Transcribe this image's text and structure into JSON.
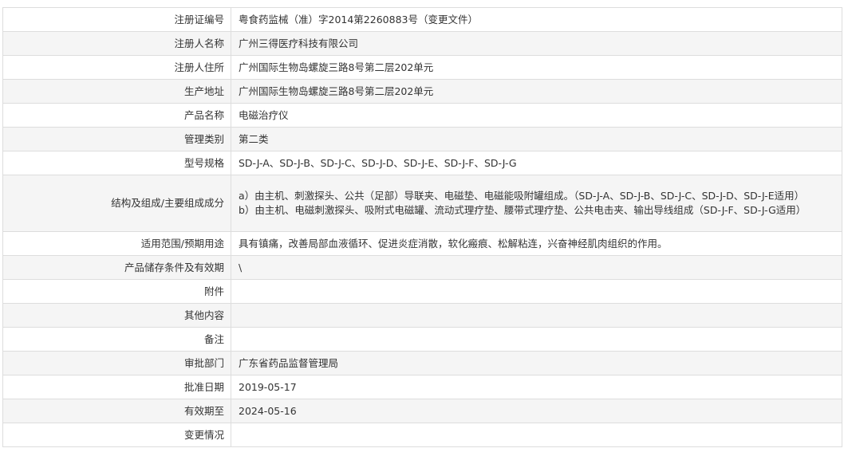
{
  "rows": [
    {
      "label": "注册证编号",
      "value": "粤食药监械（准）字2014第2260883号（变更文件）"
    },
    {
      "label": "注册人名称",
      "value": "广州三得医疗科技有限公司"
    },
    {
      "label": "注册人住所",
      "value": "广州国际生物岛螺旋三路8号第二层202单元"
    },
    {
      "label": "生产地址",
      "value": "广州国际生物岛螺旋三路8号第二层202单元"
    },
    {
      "label": "产品名称",
      "value": "电磁治疗仪"
    },
    {
      "label": "管理类别",
      "value": "第二类"
    },
    {
      "label": "型号规格",
      "value": "SD-J-A、SD-J-B、SD-J-C、SD-J-D、SD-J-E、SD-J-F、SD-J-G"
    },
    {
      "label": "结构及组成/主要组成成分",
      "lines": [
        "a）由主机、刺激探头、公共（足部）导联夹、电磁垫、电磁能吸附罐组成。（SD-J-A、SD-J-B、SD-J-C、SD-J-D、SD-J-E适用）",
        "b）由主机、电磁刺激探头、吸附式电磁罐、流动式理疗垫、腰带式理疗垫、公共电击夹、输出导线组成（SD-J-F、SD-J-G适用）"
      ]
    },
    {
      "label": "适用范围/预期用途",
      "value": "具有镇痛，改善局部血液循环、促进炎症消散，软化瘢痕、松解粘连，兴奋神经肌肉组织的作用。"
    },
    {
      "label": "产品储存条件及有效期",
      "value": "\\"
    },
    {
      "label": "附件",
      "value": ""
    },
    {
      "label": "其他内容",
      "value": ""
    },
    {
      "label": "备注",
      "value": ""
    },
    {
      "label": "审批部门",
      "value": "广东省药品监督管理局"
    },
    {
      "label": "批准日期",
      "value": "2019-05-17"
    },
    {
      "label": "有效期至",
      "value": "2024-05-16"
    },
    {
      "label": "变更情况",
      "value": ""
    }
  ]
}
